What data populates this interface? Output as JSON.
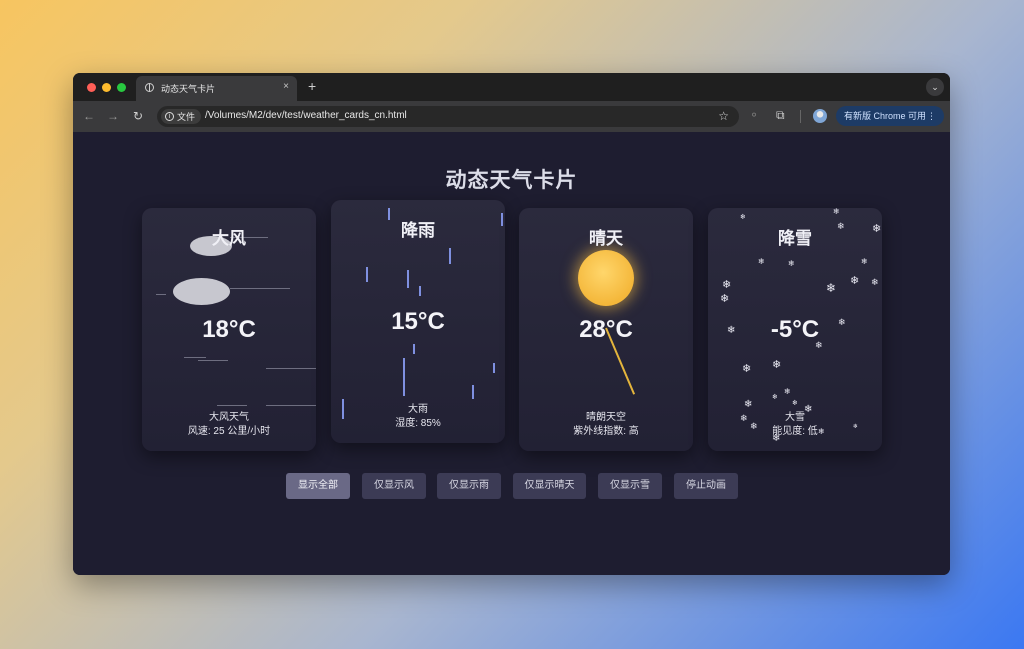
{
  "browser": {
    "tab_title": "动态天气卡片",
    "tab_close": "×",
    "new_tab": "+",
    "menu_chevron": "⌄",
    "security_chip": "文件",
    "url": "/Volumes/M2/dev/test/weather_cards_cn.html",
    "update_button": "有新版 Chrome 可用",
    "update_menu": "⋮",
    "icons": [
      "globe-icon",
      "back-icon",
      "forward-icon",
      "reload-icon",
      "info-icon",
      "star-icon",
      "extensions-icon",
      "profile-icon"
    ]
  },
  "page": {
    "title": "动态天气卡片",
    "cards": [
      {
        "title": "大风",
        "temp": "18°C",
        "desc": "大风天气",
        "detail": "风速: 25 公里/小时"
      },
      {
        "title": "降雨",
        "temp": "15°C",
        "desc": "大雨",
        "detail": "湿度: 85%"
      },
      {
        "title": "晴天",
        "temp": "28°C",
        "desc": "晴朗天空",
        "detail": "紫外线指数: 高"
      },
      {
        "title": "降雪",
        "temp": "-5°C",
        "desc": "大雪",
        "detail": "能见度: 低"
      }
    ],
    "controls": [
      {
        "label": "显示全部",
        "active": true
      },
      {
        "label": "仅显示风"
      },
      {
        "label": "仅显示雨"
      },
      {
        "label": "仅显示晴天"
      },
      {
        "label": "仅显示雪"
      },
      {
        "label": "停止动画"
      }
    ]
  },
  "colors": {
    "page_bg": "#1e1d30",
    "card_bg": "#2b2a3d",
    "button_bg": "#3c3b55",
    "button_active_bg": "#6a6986",
    "rain": "#7f90e0",
    "sun": "#f4b73a",
    "update_button_bg": "#1d3b66"
  }
}
